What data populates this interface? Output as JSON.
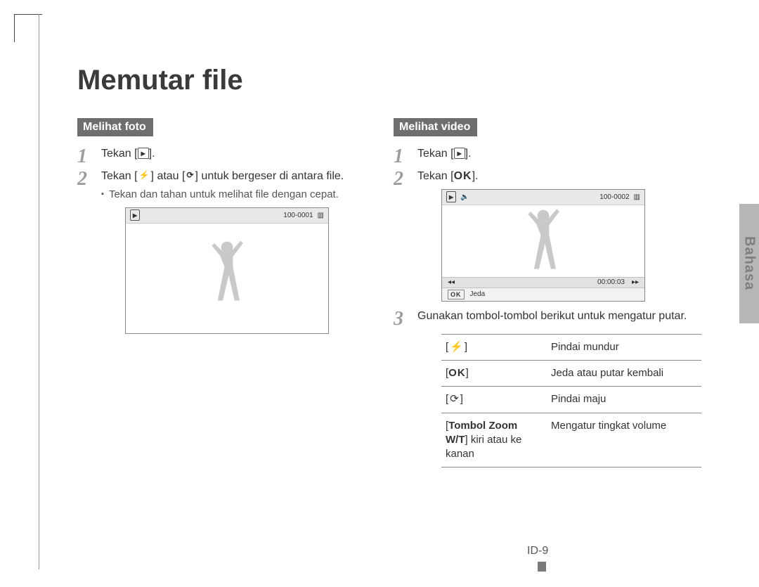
{
  "side_tab": "Bahasa",
  "page_title": "Memutar file",
  "page_number": "ID-9",
  "left": {
    "header": "Melihat foto",
    "step1_pre": "Tekan [",
    "step1_post": "].",
    "step2_pre": "Tekan [",
    "step2_mid": "] atau [",
    "step2_post": "] untuk bergeser di antara file.",
    "sub": "Tekan dan tahan untuk melihat file dengan cepat.",
    "screenshot_counter": "100-0001"
  },
  "right": {
    "header": "Melihat video",
    "step1_pre": "Tekan [",
    "step1_post": "].",
    "step2_pre": "Tekan [",
    "step2_ok": "OK",
    "step2_post": "].",
    "step3": "Gunakan tombol-tombol berikut untuk mengatur putar.",
    "screenshot_counter": "100-0002",
    "time": "00:00:03",
    "pause_label": "Jeda",
    "table": [
      {
        "key_icon": "flash",
        "desc": "Pindai mundur"
      },
      {
        "key_icon": "ok",
        "desc": "Jeda atau putar kembali"
      },
      {
        "key_icon": "timer",
        "desc": "Pindai maju"
      },
      {
        "key_text_bold": "Tombol Zoom",
        "key_text_rest1": "W/T",
        "key_text_rest2": " kiri atau ke kanan",
        "desc": "Mengatur tingkat volume"
      }
    ]
  },
  "icons": {
    "play": "▸",
    "flash": "⚡",
    "timer": "⟳",
    "ok": "OK",
    "back": "◂◂",
    "fwd": "▸▸",
    "speaker": "🔈",
    "battery": "▥"
  }
}
